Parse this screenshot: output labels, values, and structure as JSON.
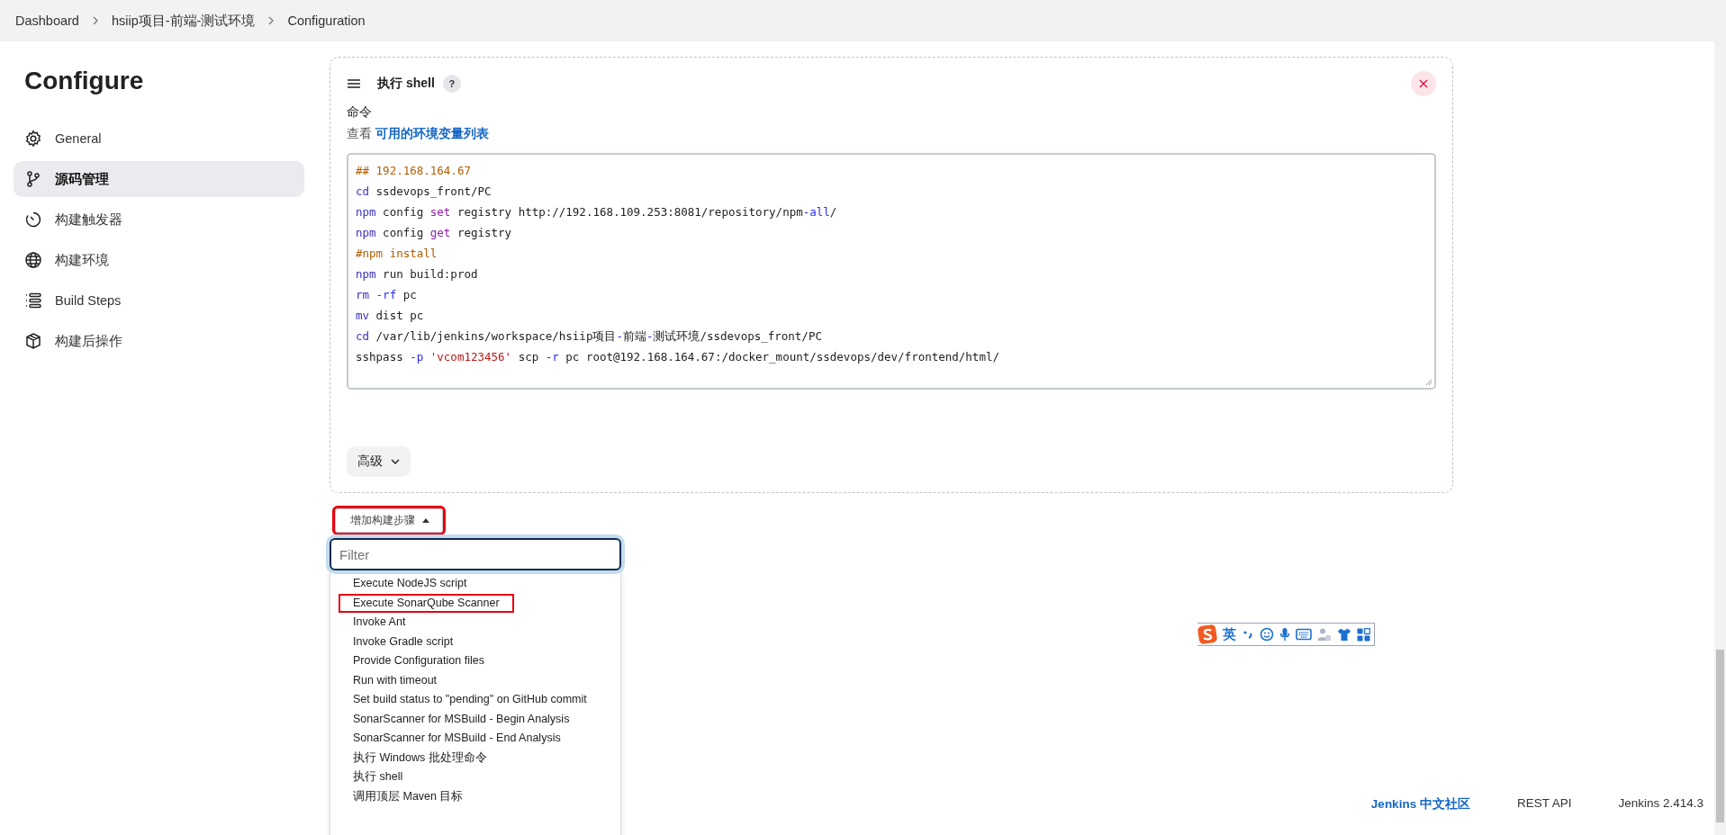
{
  "breadcrumbs": [
    {
      "label": "Dashboard"
    },
    {
      "label": "hsiip项目-前端-测试环境"
    },
    {
      "label": "Configuration"
    }
  ],
  "sidebar": {
    "title": "Configure",
    "items": [
      {
        "label": "General",
        "selected": false
      },
      {
        "label": "源码管理",
        "selected": true
      },
      {
        "label": "构建触发器",
        "selected": false
      },
      {
        "label": "构建环境",
        "selected": false
      },
      {
        "label": "Build Steps",
        "selected": false
      },
      {
        "label": "构建后操作",
        "selected": false
      }
    ]
  },
  "build_step": {
    "title": "执行 shell",
    "help": "?",
    "command_label": "命令",
    "env_hint": "查看",
    "env_link": "可用的环境变量列表",
    "advanced_button": "高级",
    "code_lines": [
      [
        {
          "text": "## 192.168.164.67",
          "kind": "comment"
        }
      ],
      [
        {
          "text": "cd",
          "kind": "builtin"
        },
        {
          "text": " ssdevops_front/PC",
          "kind": "plain"
        }
      ],
      [
        {
          "text": "npm",
          "kind": "builtin"
        },
        {
          "text": " config ",
          "kind": "plain"
        },
        {
          "text": "set",
          "kind": "keyword"
        },
        {
          "text": " registry http://192.168.109.253:8081/repository/npm",
          "kind": "plain"
        },
        {
          "text": "-all",
          "kind": "flag"
        },
        {
          "text": "/",
          "kind": "plain"
        }
      ],
      [
        {
          "text": "npm",
          "kind": "builtin"
        },
        {
          "text": " config ",
          "kind": "plain"
        },
        {
          "text": "get",
          "kind": "keyword"
        },
        {
          "text": " registry",
          "kind": "plain"
        }
      ],
      [
        {
          "text": "#npm install",
          "kind": "comment"
        }
      ],
      [
        {
          "text": "npm",
          "kind": "builtin"
        },
        {
          "text": " run build:prod",
          "kind": "plain"
        }
      ],
      [
        {
          "text": "rm",
          "kind": "builtin"
        },
        {
          "text": " -rf",
          "kind": "flag"
        },
        {
          "text": " pc",
          "kind": "plain"
        }
      ],
      [
        {
          "text": "mv",
          "kind": "builtin"
        },
        {
          "text": " dist pc",
          "kind": "plain"
        }
      ],
      [
        {
          "text": "cd",
          "kind": "builtin"
        },
        {
          "text": " /var/lib/jenkins/workspace/hsiip项目",
          "kind": "plain"
        },
        {
          "text": "-",
          "kind": "flag"
        },
        {
          "text": "前端",
          "kind": "plain"
        },
        {
          "text": "-",
          "kind": "flag"
        },
        {
          "text": "测试环境/ssdevops_front/PC",
          "kind": "plain"
        }
      ],
      [
        {
          "text": "sshpass",
          "kind": "plain"
        },
        {
          "text": " -p",
          "kind": "flag"
        },
        {
          "text": " 'vcom123456'",
          "kind": "string"
        },
        {
          "text": " scp",
          "kind": "plain"
        },
        {
          "text": " -r",
          "kind": "flag"
        },
        {
          "text": " pc root@192.168.164.67:/docker_mount/ssdevops/dev/frontend/html/",
          "kind": "plain"
        }
      ]
    ]
  },
  "add_step": {
    "label": "增加构建步骤",
    "highlighted": true,
    "expanded": true
  },
  "step_menu": {
    "filter_placeholder": "Filter",
    "items": [
      {
        "label": "Execute NodeJS script",
        "highlighted": false
      },
      {
        "label": "Execute SonarQube Scanner",
        "highlighted": true
      },
      {
        "label": "Invoke Ant",
        "highlighted": false
      },
      {
        "label": "Invoke Gradle script",
        "highlighted": false
      },
      {
        "label": "Provide Configuration files",
        "highlighted": false
      },
      {
        "label": "Run with timeout",
        "highlighted": false
      },
      {
        "label": "Set build status to \"pending\" on GitHub commit",
        "highlighted": false
      },
      {
        "label": "SonarScanner for MSBuild - Begin Analysis",
        "highlighted": false
      },
      {
        "label": "SonarScanner for MSBuild - End Analysis",
        "highlighted": false
      },
      {
        "label": "执行 Windows 批处理命令",
        "highlighted": false
      },
      {
        "label": "执行 shell",
        "highlighted": false
      },
      {
        "label": "调用顶层 Maven 目标",
        "highlighted": false
      }
    ]
  },
  "ime_toolbar": {
    "mode": "英"
  },
  "footer": {
    "community_link": "Jenkins 中文社区",
    "api_link": "REST API",
    "version": "Jenkins 2.414.3"
  }
}
